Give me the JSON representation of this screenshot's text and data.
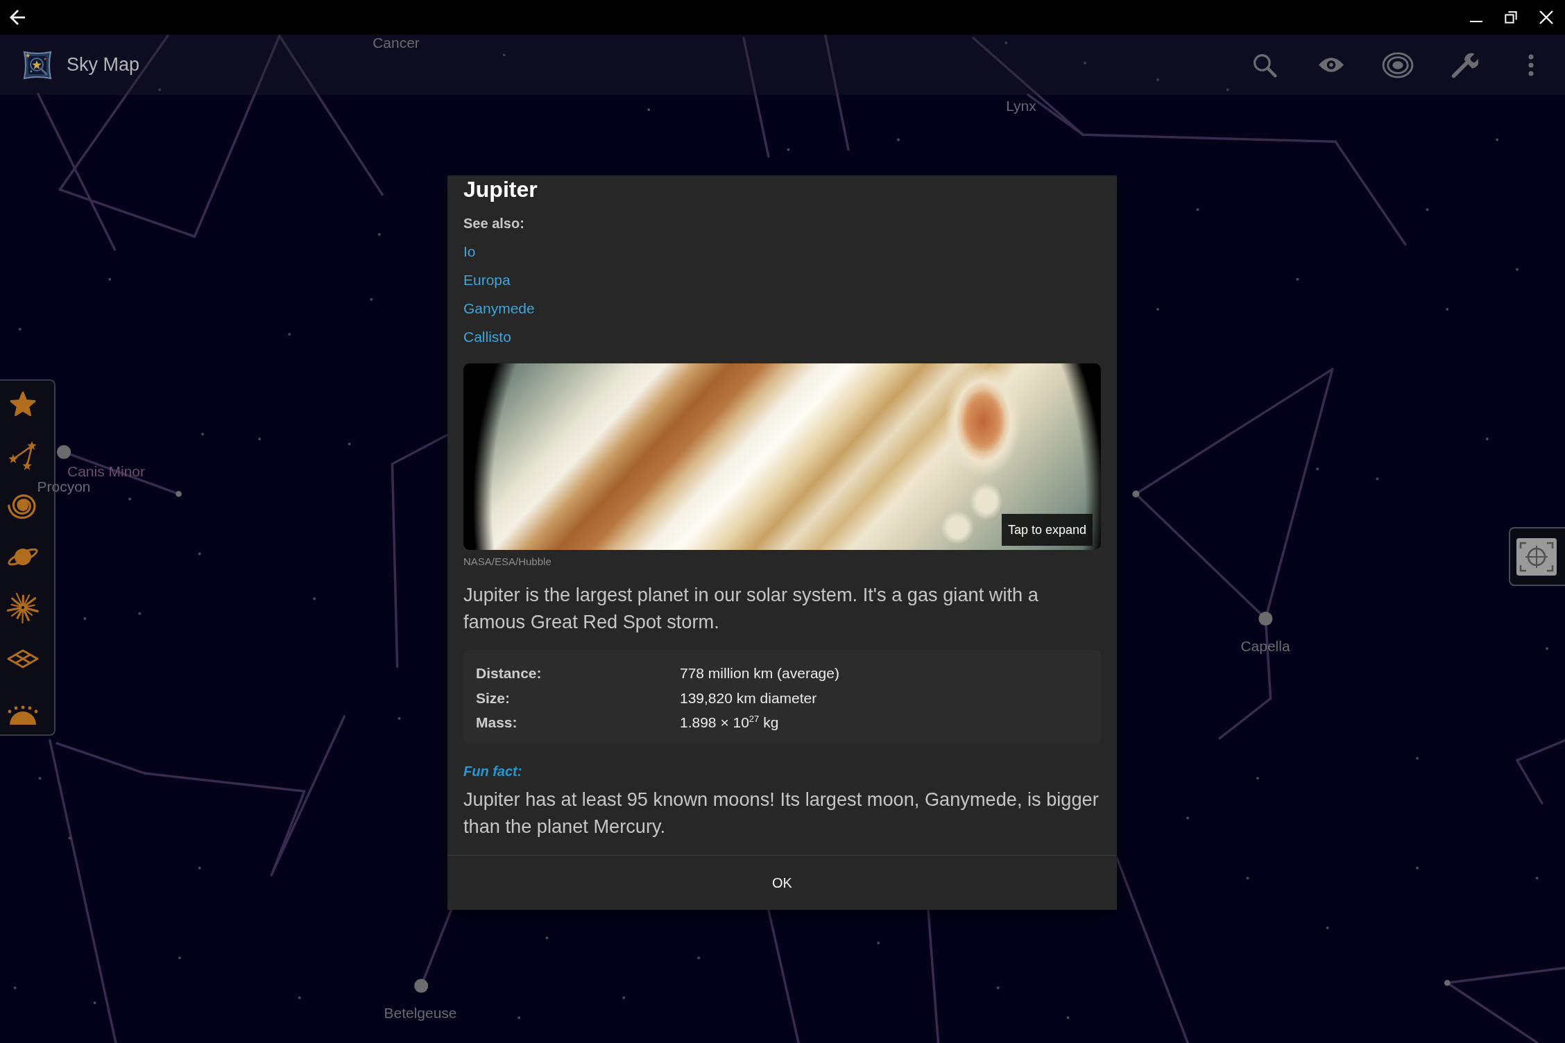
{
  "app_bar": {
    "title": "Sky Map"
  },
  "sky": {
    "labels": [
      {
        "text": "Cancer",
        "color": "#6a6a6e"
      },
      {
        "text": "Lynx",
        "color": "#6a6a6e"
      },
      {
        "text": "Canis Minor",
        "color": "#6b4e6c"
      },
      {
        "text": "Procyon",
        "color": "#6a6a6e"
      },
      {
        "text": "Capella",
        "color": "#6a6a6e"
      },
      {
        "text": "Betelgeuse",
        "color": "#6a6a6e"
      }
    ]
  },
  "dialog": {
    "title": "Jupiter",
    "see_also_label": "See also:",
    "see_also": [
      "Io",
      "Europa",
      "Ganymede",
      "Callisto"
    ],
    "photo": {
      "hint": "Tap to expand",
      "credit": "NASA/ESA/Hubble"
    },
    "description": "Jupiter is the largest planet in our solar system. It's a gas giant with a famous Great Red Spot storm.",
    "facts": [
      {
        "label": "Distance:",
        "value": "778 million km (average)"
      },
      {
        "label": "Size:",
        "value": "139,820 km diameter"
      },
      {
        "label": "Mass:",
        "value": "1.898 × 10$^{27}$ kg"
      }
    ],
    "fun_fact": {
      "label": "Fun fact:",
      "text": "Jupiter has at least 95 known moons! Its largest moon, Ganymede, is bigger than the planet Mercury."
    },
    "buttons": [
      "OK"
    ]
  }
}
